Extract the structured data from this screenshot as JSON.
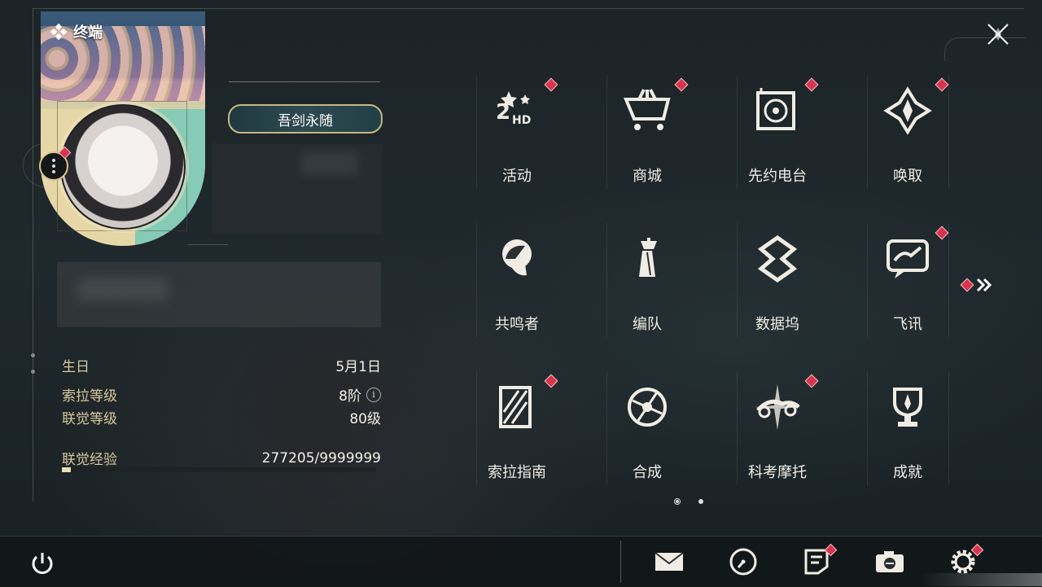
{
  "header": {
    "title": "终端"
  },
  "profile": {
    "name": "吾剑永随",
    "stats": [
      {
        "label": "生日",
        "value": "5月1日"
      },
      {
        "label": "索拉等级",
        "value": "8阶",
        "info": "i"
      },
      {
        "label": "联觉等级",
        "value": "80级"
      },
      {
        "label": "联觉经验",
        "value": "277205/9999999"
      }
    ],
    "exp_progress": 0.0277
  },
  "menu": {
    "items": [
      {
        "label": "活动",
        "icon": "event-2hd-icon",
        "badge": true
      },
      {
        "label": "商城",
        "icon": "shop-cart-icon",
        "badge": true
      },
      {
        "label": "先约电台",
        "icon": "radio-icon",
        "badge": true
      },
      {
        "label": "唤取",
        "icon": "convene-icon",
        "badge": true
      },
      {
        "label": "共鸣者",
        "icon": "resonator-icon",
        "badge": false
      },
      {
        "label": "编队",
        "icon": "team-chess-icon",
        "badge": false
      },
      {
        "label": "数据坞",
        "icon": "data-bank-icon",
        "badge": false
      },
      {
        "label": "飞讯",
        "icon": "messenger-icon",
        "badge": true
      },
      {
        "label": "索拉指南",
        "icon": "guide-icon",
        "badge": true
      },
      {
        "label": "合成",
        "icon": "synthesis-icon",
        "badge": false
      },
      {
        "label": "科考摩托",
        "icon": "motorbike-icon",
        "badge": true
      },
      {
        "label": "成就",
        "icon": "trophy-icon",
        "badge": false
      }
    ],
    "page": 1,
    "page_count": 2
  },
  "bottom": {
    "items": [
      {
        "name": "mail",
        "icon": "mail-icon",
        "badge": false
      },
      {
        "name": "clock",
        "icon": "clock-icon",
        "badge": false
      },
      {
        "name": "notice",
        "icon": "notice-icon",
        "badge": true
      },
      {
        "name": "camera",
        "icon": "camera-icon",
        "badge": false
      },
      {
        "name": "settings",
        "icon": "gear-icon",
        "badge": true
      }
    ]
  },
  "colors": {
    "accent_gold": "#d8c58c",
    "badge_red": "#d8344e",
    "text_gold": "#d9c99a"
  }
}
